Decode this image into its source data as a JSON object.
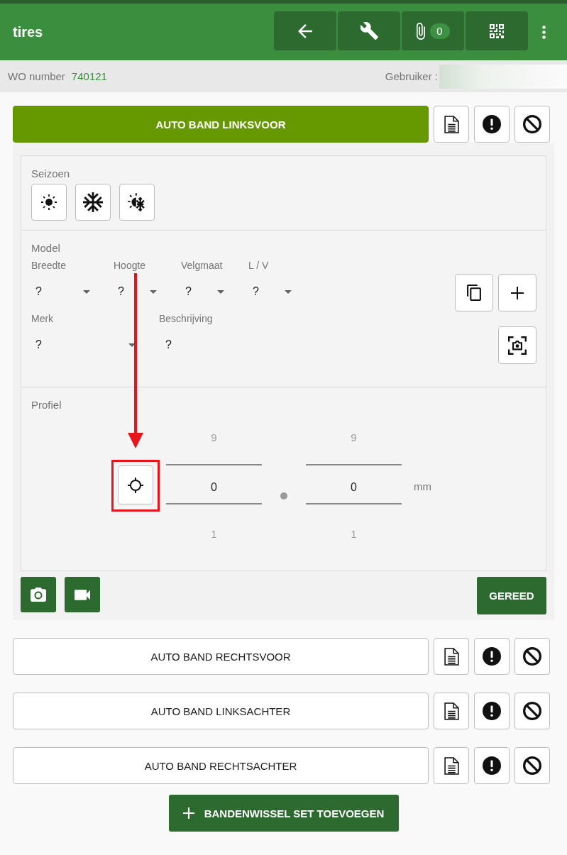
{
  "app_bar": {
    "title": "tires",
    "actions": [
      {
        "kind": "back"
      },
      {
        "kind": "tools"
      },
      {
        "kind": "attachments",
        "badge": "0"
      },
      {
        "kind": "qr"
      }
    ]
  },
  "info_bar": {
    "wo_label": "WO number",
    "wo_number": "740121",
    "user_label": "Gebruiker :"
  },
  "tires": [
    {
      "label": "AUTO BAND LINKSVOOR",
      "expanded": true,
      "details": {
        "season": {
          "label": "Seizoen",
          "options": [
            {
              "kind": "summer",
              "selected": false
            },
            {
              "kind": "winter",
              "selected": false
            },
            {
              "kind": "all_season",
              "selected": false
            }
          ]
        },
        "model": {
          "label": "Model",
          "size_fields": [
            {
              "kind": "select",
              "label": "Breedte",
              "value": "?"
            },
            {
              "kind": "select",
              "label": "Hoogte",
              "value": "?"
            },
            {
              "kind": "select",
              "label": "Velgmaat",
              "value": "?"
            },
            {
              "kind": "select",
              "label": "L / V",
              "value": "?"
            }
          ],
          "info_fields": [
            {
              "kind": "select",
              "label": "Merk",
              "value": "?"
            },
            {
              "kind": "text",
              "label": "Beschrijving",
              "value": "?"
            }
          ]
        },
        "profile": {
          "label": "Profiel",
          "locate_highlighted": true,
          "wheels": [
            {
              "above": "9",
              "value": "0",
              "below": "1"
            },
            {
              "above": "9",
              "value": "0",
              "below": "1"
            }
          ],
          "unit": "mm"
        },
        "done_label": "GEREED"
      }
    },
    {
      "label": "AUTO BAND RECHTSVOOR",
      "expanded": false
    },
    {
      "label": "AUTO BAND LINKSACHTER",
      "expanded": false
    },
    {
      "label": "AUTO BAND RECHTSACHTER",
      "expanded": false
    }
  ],
  "add_button": {
    "label": "BANDENWISSEL SET TOEVOEGEN"
  }
}
